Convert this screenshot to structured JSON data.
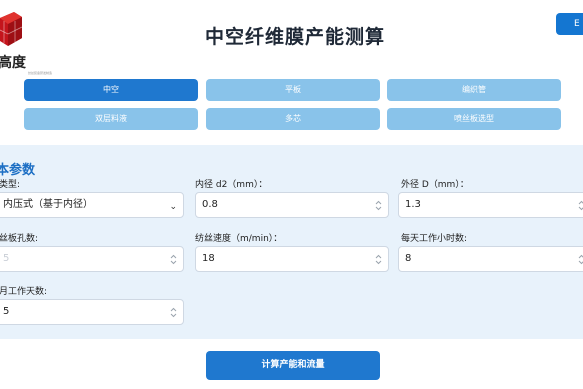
{
  "header": {
    "title": "中空纤维膜产能测算",
    "brand": "高度",
    "brand_sub": "纺丝装备研发制造",
    "top_button_label": "E"
  },
  "tabs": [
    {
      "label": "中空",
      "active": true
    },
    {
      "label": "平板",
      "active": false
    },
    {
      "label": "编织管",
      "active": false
    },
    {
      "label": "双层料液",
      "active": false
    },
    {
      "label": "多芯",
      "active": false
    },
    {
      "label": "喷丝板选型",
      "active": false
    }
  ],
  "section": {
    "title": "本参数"
  },
  "fields": {
    "type": {
      "label": "类型:",
      "value": "内压式（基于内径）"
    },
    "inner_d": {
      "label": "内径 d2（mm）：",
      "value": "0.8"
    },
    "outer_d": {
      "label": "外径 D（mm）：",
      "value": "1.3"
    },
    "holes": {
      "label": "丝板孔数:",
      "value": "5"
    },
    "speed": {
      "label": "纺丝速度（m/min）：",
      "value": "18"
    },
    "hours": {
      "label": "每天工作小时数:",
      "value": "8"
    },
    "days": {
      "label": "月工作天数:",
      "value": "5"
    }
  },
  "calc_button": "计算产能和流量",
  "colors": {
    "primary": "#1f78cf",
    "tab_inactive": "#89c3ea",
    "panel": "#e8f2fb"
  }
}
